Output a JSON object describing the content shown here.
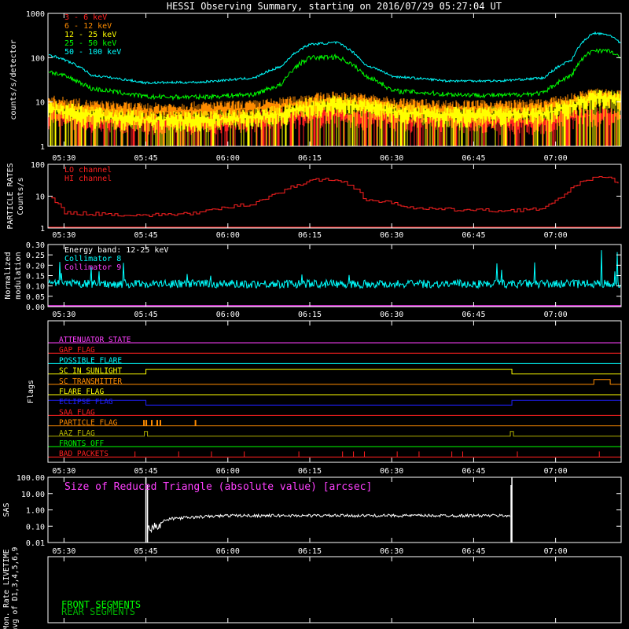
{
  "title": "HESSI Observing Summary, starting on 2016/07/29 05:27:04 UT",
  "time_axis": {
    "start": "05:27:04",
    "end": "07:12:00",
    "ticks": [
      "05:30",
      "05:45",
      "06:00",
      "06:15",
      "06:30",
      "06:45",
      "07:00"
    ]
  },
  "chart_data": [
    {
      "type": "line",
      "name": "count_rates",
      "ylabel": "counts/s/detector",
      "yscale": "log",
      "ylim": [
        1,
        1000
      ],
      "yticks": [
        "1",
        "10",
        "100",
        "1000"
      ],
      "x": [
        "05:27",
        "05:35",
        "05:45",
        "05:55",
        "06:05",
        "06:10",
        "06:15",
        "06:20",
        "06:25",
        "06:30",
        "06:40",
        "06:50",
        "06:58",
        "07:03",
        "07:07",
        "07:10",
        "07:12"
      ],
      "series": [
        {
          "name": "3 - 6 keV",
          "color": "#ff2020",
          "values": [
            4.5,
            4,
            3.5,
            3.5,
            4,
            4.5,
            5,
            5,
            4.5,
            4,
            4,
            3.5,
            3.5,
            4.5,
            5,
            5,
            4.5
          ]
        },
        {
          "name": "6 - 12 keV",
          "color": "#ff8c00",
          "values": [
            9,
            7,
            6,
            6.5,
            7,
            8,
            10,
            11,
            10,
            8,
            7,
            7,
            7.5,
            10,
            13,
            13,
            12
          ]
        },
        {
          "name": "12 - 25 keV",
          "color": "#ffff00",
          "values": [
            7,
            5,
            4,
            4,
            4.5,
            5.5,
            8,
            9,
            8,
            6,
            5,
            5,
            5.5,
            8,
            12,
            12,
            11
          ]
        },
        {
          "name": "25 - 50 keV",
          "color": "#00ff00",
          "values": [
            50,
            20,
            13,
            13,
            15,
            25,
            100,
            105,
            40,
            18,
            15,
            14,
            16,
            40,
            150,
            140,
            90
          ]
        },
        {
          "name": "50 - 100 keV",
          "color": "#00ffff",
          "values": [
            120,
            40,
            27,
            28,
            35,
            65,
            200,
            220,
            70,
            38,
            30,
            30,
            35,
            90,
            360,
            320,
            200
          ]
        }
      ]
    },
    {
      "type": "line",
      "name": "particle_rates",
      "ylabel": "PARTICLE RATES",
      "ylabel2": "Counts/s",
      "yscale": "log",
      "ylim": [
        1,
        100
      ],
      "yticks": [
        "1",
        "10",
        "100"
      ],
      "x": [
        "05:27",
        "05:30",
        "05:45",
        "05:55",
        "06:05",
        "06:10",
        "06:15",
        "06:18",
        "06:22",
        "06:25",
        "06:35",
        "06:50",
        "06:58",
        "07:02",
        "07:07",
        "07:10",
        "07:12"
      ],
      "series": [
        {
          "name": "LO channel",
          "color": "#ff2020",
          "values": [
            10,
            3,
            2.5,
            3,
            6,
            14,
            30,
            35,
            25,
            8,
            4,
            3.5,
            4,
            12,
            40,
            35,
            25
          ]
        },
        {
          "name": "HI channel",
          "color": "#ff2020",
          "values": [
            1,
            1,
            1,
            1,
            1,
            1,
            1,
            1,
            1,
            1,
            1,
            1,
            1,
            1,
            1,
            1,
            1
          ]
        }
      ]
    },
    {
      "type": "line",
      "name": "modulation",
      "ylabel": "Normalized",
      "ylabel2": "modulation",
      "ylim": [
        0,
        0.3
      ],
      "yticks": [
        "0.00",
        "0.05",
        "0.10",
        "0.15",
        "0.20",
        "0.25",
        "0.30"
      ],
      "annotation": "Energy band: 12-25 keV",
      "series": [
        {
          "name": "Collimator 8",
          "color": "#00ffff",
          "mean": 0.11,
          "peaks": [
            0.22,
            0.2,
            0.25,
            0.28
          ]
        },
        {
          "name": "Collimator 9",
          "color": "#ff40ff",
          "mean": 0.0
        }
      ]
    },
    {
      "type": "table",
      "name": "flags",
      "ylabel": "Flags",
      "rows": [
        {
          "label": "ATTENUATOR STATE",
          "color": "#ff40ff"
        },
        {
          "label": "GAP FLAG",
          "color": "#ff2020"
        },
        {
          "label": "POSSIBLE FLARE",
          "color": "#00ffff"
        },
        {
          "label": "SC IN SUNLIGHT",
          "color": "#ffff00"
        },
        {
          "label": "SC TRANSMITTER",
          "color": "#ff8c00"
        },
        {
          "label": "FLARE FLAG",
          "color": "#ffff00"
        },
        {
          "label": "ECLIPSE FLAG",
          "color": "#2020ff"
        },
        {
          "label": "SAA FLAG",
          "color": "#ff2020"
        },
        {
          "label": "PARTICLE FLAG",
          "color": "#ff8c00"
        },
        {
          "label": "AAZ FLAG",
          "color": "#b0b000"
        },
        {
          "label": "FRONTS OFF",
          "color": "#00ff00"
        },
        {
          "label": "BAD PACKETS",
          "color": "#ff2020"
        }
      ]
    },
    {
      "type": "line",
      "name": "sas",
      "ylabel": "SAS",
      "yscale": "log",
      "ylim": [
        0.01,
        100
      ],
      "yticks": [
        "0.01",
        "0.10",
        "1.00",
        "10.00",
        "100.00"
      ],
      "annotation": "Size of Reduced Triangle (absolute value) [arcsec]",
      "series": [
        {
          "name": "SAS",
          "color": "#ffffff",
          "x": [
            "05:45",
            "05:47",
            "05:50",
            "06:00",
            "06:30",
            "06:52"
          ],
          "values": [
            0.05,
            0.15,
            0.3,
            0.45,
            0.45,
            0.45
          ]
        }
      ]
    },
    {
      "type": "line",
      "name": "livetime",
      "ylabel": "Mon. Rate LIVETIME",
      "ylabel2": "avg of D1,3,4,5,6,9",
      "series": [
        {
          "name": "FRONT SEGMENTS",
          "color": "#00ff00"
        },
        {
          "name": "REAR SEGMENTS",
          "color": "#00b000"
        }
      ]
    }
  ]
}
